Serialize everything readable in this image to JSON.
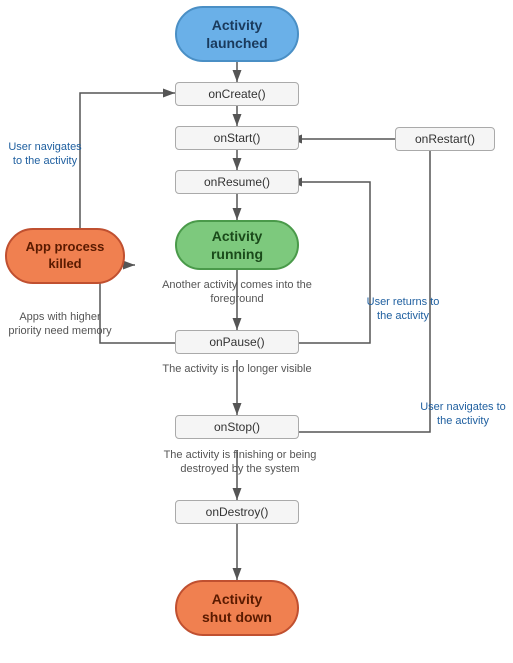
{
  "nodes": {
    "activity_launched": {
      "label": "Activity\nlaunched"
    },
    "on_create": {
      "label": "onCreate()"
    },
    "on_start": {
      "label": "onStart()"
    },
    "on_resume": {
      "label": "onResume()"
    },
    "activity_running": {
      "label": "Activity\nrunning"
    },
    "on_pause": {
      "label": "onPause()"
    },
    "on_stop": {
      "label": "onStop()"
    },
    "on_destroy": {
      "label": "onDestroy()"
    },
    "activity_shutdown": {
      "label": "Activity\nshut down"
    },
    "on_restart": {
      "label": "onRestart()"
    },
    "app_process_killed": {
      "label": "App process\nkilled"
    }
  },
  "labels": {
    "user_navigates_1": "User navigates\nto the activity",
    "another_activity": "Another activity comes\ninto the foreground",
    "no_longer_visible": "The activity is\nno longer visible",
    "finishing": "The activity is finishing or\nbeing destroyed by the system",
    "user_returns": "User returns\nto the activity",
    "user_navigates_2": "User navigates\nto the activity",
    "apps_higher_priority": "Apps with higher priority\nneed memory"
  },
  "colors": {
    "blue": "#6ab0e8",
    "green": "#7dc97d",
    "orange": "#f08050",
    "arrow": "#555",
    "blue_label": "#2060a0"
  }
}
